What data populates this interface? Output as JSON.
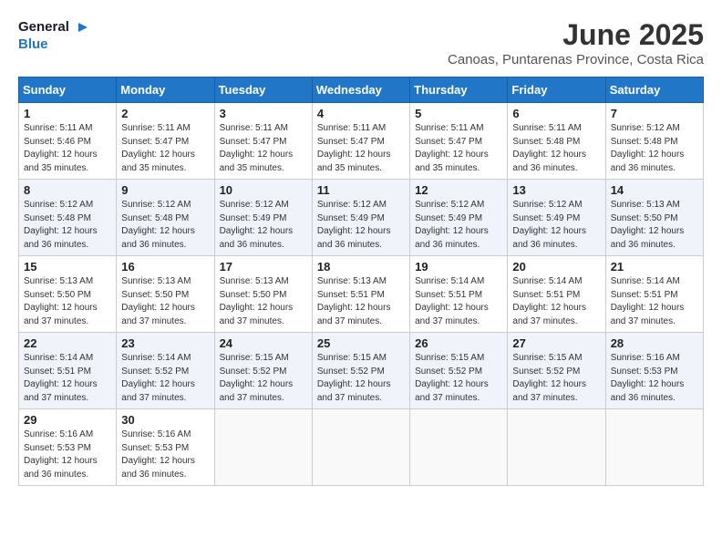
{
  "header": {
    "logo_line1": "General",
    "logo_line2": "Blue",
    "month": "June 2025",
    "location": "Canoas, Puntarenas Province, Costa Rica"
  },
  "days_of_week": [
    "Sunday",
    "Monday",
    "Tuesday",
    "Wednesday",
    "Thursday",
    "Friday",
    "Saturday"
  ],
  "weeks": [
    [
      {
        "day": "1",
        "sunrise": "5:11 AM",
        "sunset": "5:46 PM",
        "daylight": "12 hours and 35 minutes."
      },
      {
        "day": "2",
        "sunrise": "5:11 AM",
        "sunset": "5:47 PM",
        "daylight": "12 hours and 35 minutes."
      },
      {
        "day": "3",
        "sunrise": "5:11 AM",
        "sunset": "5:47 PM",
        "daylight": "12 hours and 35 minutes."
      },
      {
        "day": "4",
        "sunrise": "5:11 AM",
        "sunset": "5:47 PM",
        "daylight": "12 hours and 35 minutes."
      },
      {
        "day": "5",
        "sunrise": "5:11 AM",
        "sunset": "5:47 PM",
        "daylight": "12 hours and 35 minutes."
      },
      {
        "day": "6",
        "sunrise": "5:11 AM",
        "sunset": "5:48 PM",
        "daylight": "12 hours and 36 minutes."
      },
      {
        "day": "7",
        "sunrise": "5:12 AM",
        "sunset": "5:48 PM",
        "daylight": "12 hours and 36 minutes."
      }
    ],
    [
      {
        "day": "8",
        "sunrise": "5:12 AM",
        "sunset": "5:48 PM",
        "daylight": "12 hours and 36 minutes."
      },
      {
        "day": "9",
        "sunrise": "5:12 AM",
        "sunset": "5:48 PM",
        "daylight": "12 hours and 36 minutes."
      },
      {
        "day": "10",
        "sunrise": "5:12 AM",
        "sunset": "5:49 PM",
        "daylight": "12 hours and 36 minutes."
      },
      {
        "day": "11",
        "sunrise": "5:12 AM",
        "sunset": "5:49 PM",
        "daylight": "12 hours and 36 minutes."
      },
      {
        "day": "12",
        "sunrise": "5:12 AM",
        "sunset": "5:49 PM",
        "daylight": "12 hours and 36 minutes."
      },
      {
        "day": "13",
        "sunrise": "5:12 AM",
        "sunset": "5:49 PM",
        "daylight": "12 hours and 36 minutes."
      },
      {
        "day": "14",
        "sunrise": "5:13 AM",
        "sunset": "5:50 PM",
        "daylight": "12 hours and 36 minutes."
      }
    ],
    [
      {
        "day": "15",
        "sunrise": "5:13 AM",
        "sunset": "5:50 PM",
        "daylight": "12 hours and 37 minutes."
      },
      {
        "day": "16",
        "sunrise": "5:13 AM",
        "sunset": "5:50 PM",
        "daylight": "12 hours and 37 minutes."
      },
      {
        "day": "17",
        "sunrise": "5:13 AM",
        "sunset": "5:50 PM",
        "daylight": "12 hours and 37 minutes."
      },
      {
        "day": "18",
        "sunrise": "5:13 AM",
        "sunset": "5:51 PM",
        "daylight": "12 hours and 37 minutes."
      },
      {
        "day": "19",
        "sunrise": "5:14 AM",
        "sunset": "5:51 PM",
        "daylight": "12 hours and 37 minutes."
      },
      {
        "day": "20",
        "sunrise": "5:14 AM",
        "sunset": "5:51 PM",
        "daylight": "12 hours and 37 minutes."
      },
      {
        "day": "21",
        "sunrise": "5:14 AM",
        "sunset": "5:51 PM",
        "daylight": "12 hours and 37 minutes."
      }
    ],
    [
      {
        "day": "22",
        "sunrise": "5:14 AM",
        "sunset": "5:51 PM",
        "daylight": "12 hours and 37 minutes."
      },
      {
        "day": "23",
        "sunrise": "5:14 AM",
        "sunset": "5:52 PM",
        "daylight": "12 hours and 37 minutes."
      },
      {
        "day": "24",
        "sunrise": "5:15 AM",
        "sunset": "5:52 PM",
        "daylight": "12 hours and 37 minutes."
      },
      {
        "day": "25",
        "sunrise": "5:15 AM",
        "sunset": "5:52 PM",
        "daylight": "12 hours and 37 minutes."
      },
      {
        "day": "26",
        "sunrise": "5:15 AM",
        "sunset": "5:52 PM",
        "daylight": "12 hours and 37 minutes."
      },
      {
        "day": "27",
        "sunrise": "5:15 AM",
        "sunset": "5:52 PM",
        "daylight": "12 hours and 37 minutes."
      },
      {
        "day": "28",
        "sunrise": "5:16 AM",
        "sunset": "5:53 PM",
        "daylight": "12 hours and 36 minutes."
      }
    ],
    [
      {
        "day": "29",
        "sunrise": "5:16 AM",
        "sunset": "5:53 PM",
        "daylight": "12 hours and 36 minutes."
      },
      {
        "day": "30",
        "sunrise": "5:16 AM",
        "sunset": "5:53 PM",
        "daylight": "12 hours and 36 minutes."
      },
      null,
      null,
      null,
      null,
      null
    ]
  ]
}
